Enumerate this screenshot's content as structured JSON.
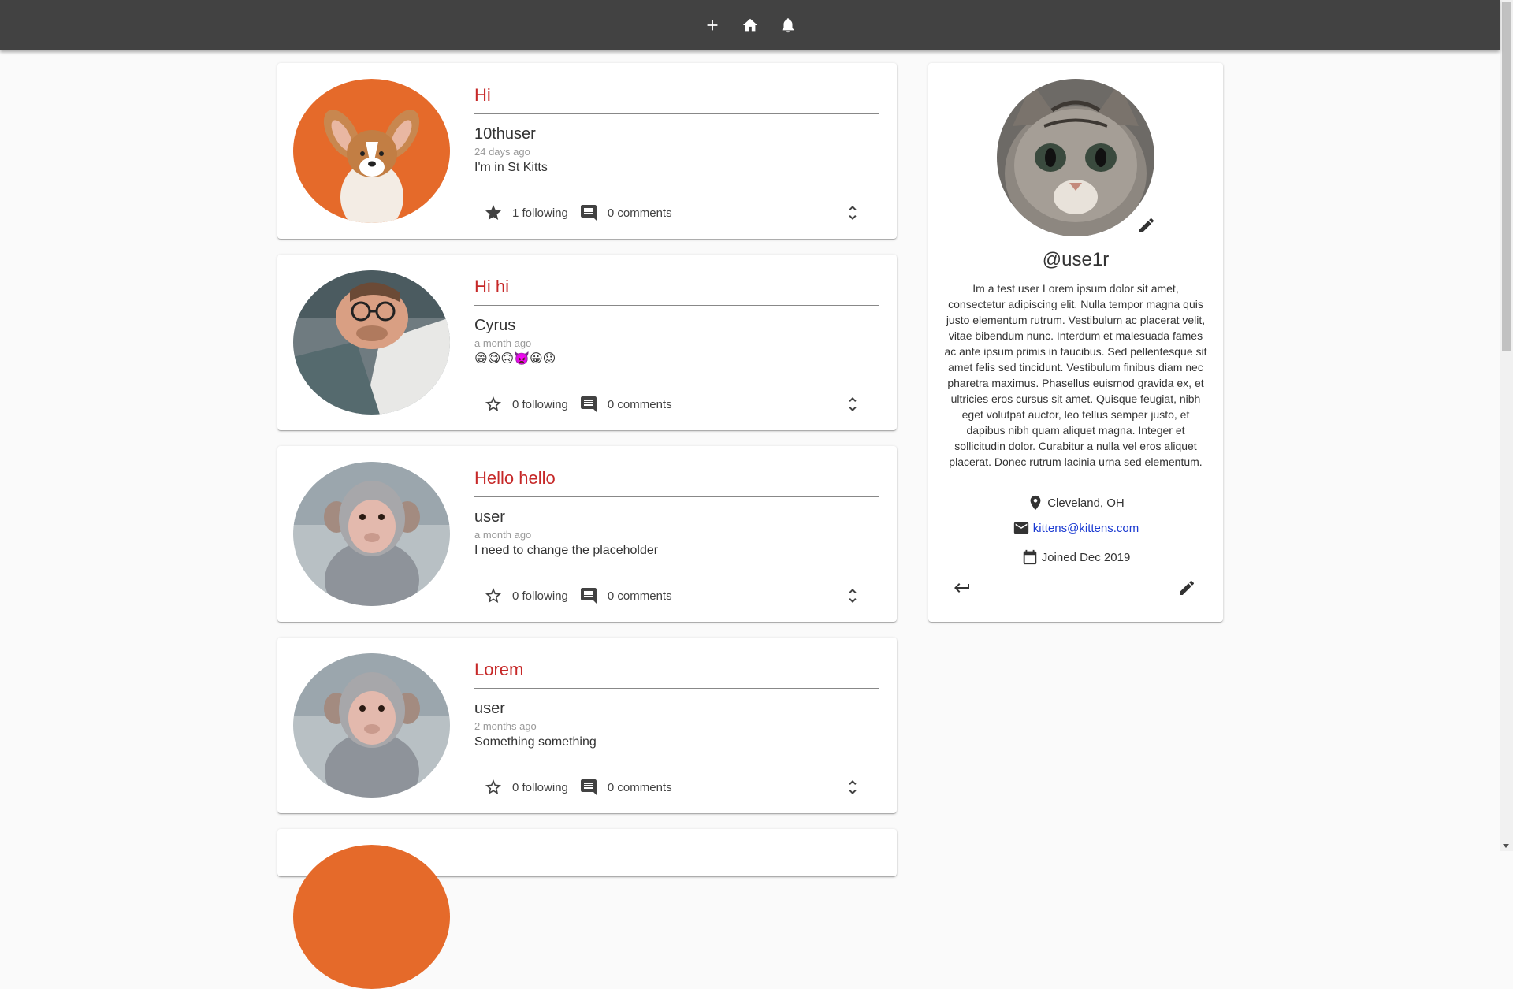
{
  "topbar": {
    "icons": [
      "add-icon",
      "home-icon",
      "notifications-icon"
    ]
  },
  "posts": [
    {
      "title": "Hi",
      "author": "10thuser",
      "time": "24 days ago",
      "body": "I'm in St Kitts",
      "following": "1 following",
      "comments": "0 comments",
      "starred": true,
      "avatar": "corgi-dog-photo"
    },
    {
      "title": "Hi hi",
      "author": "Cyrus",
      "time": "a month ago",
      "body": "😁😋🙃👿😀😟",
      "following": "0 following",
      "comments": "0 comments",
      "starred": false,
      "avatar": "man-with-glasses-photo"
    },
    {
      "title": "Hello hello",
      "author": "user",
      "time": "a month ago",
      "body": "I need to change the placeholder",
      "following": "0 following",
      "comments": "0 comments",
      "starred": false,
      "avatar": "monkey-photo"
    },
    {
      "title": "Lorem",
      "author": "user",
      "time": "2 months ago",
      "body": "Something something",
      "following": "0 following",
      "comments": "0 comments",
      "starred": false,
      "avatar": "monkey-photo"
    }
  ],
  "profile": {
    "handle": "@use1r",
    "bio": "Im a test user Lorem ipsum dolor sit amet, consectetur adipiscing elit. Nulla tempor magna quis justo elementum rutrum. Vestibulum ac placerat velit, vitae bibendum nunc. Interdum et malesuada fames ac ante ipsum primis in faucibus. Sed pellentesque sit amet felis sed tincidunt. Vestibulum finibus diam nec pharetra maximus. Phasellus euismod gravida ex, et ultricies eros cursus sit amet. Quisque feugiat, nibh eget volutpat auctor, leo tellus semper justo, et dapibus nibh quam aliquet magna. Integer et sollicitudin dolor. Curabitur a nulla vel eros aliquet placerat. Donec rutrum lacinia urna sed elementum.",
    "location": "Cleveland, OH",
    "email": "kittens@kittens.com",
    "joined": "Joined Dec 2019",
    "avatar": "kitten-photo"
  },
  "colors": {
    "topbar": "#424242",
    "title_accent": "#c62828",
    "link": "#1a3ad1",
    "page_bg": "#fafafa"
  }
}
